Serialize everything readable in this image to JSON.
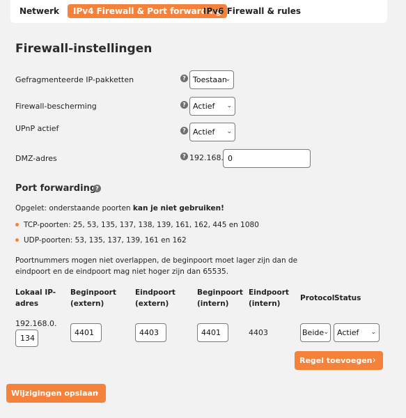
{
  "tabs": [
    {
      "label": "Netwerk"
    },
    {
      "label": "IPv4 Firewall & Port forwarding"
    },
    {
      "label": "IPv6 Firewall & rules"
    }
  ],
  "section_title": "Firewall-instellingen",
  "help_glyph": "?",
  "settings": {
    "fragmented": {
      "label": "Gefragmenteerde IP-pakketten",
      "value": "Toestaan"
    },
    "protection": {
      "label": "Firewall-bescherming",
      "value": "Actief"
    },
    "upnp": {
      "label": "UPnP actief",
      "value": "Actief"
    },
    "dmz": {
      "label": "DMZ-adres",
      "prefix": "192.168.0.",
      "value": "0"
    }
  },
  "port_forwarding": {
    "title": "Port forwarding",
    "warning_prefix": "Opgelet: onderstaande poorten ",
    "warning_bold": "kan je niet gebruiken!",
    "tcp": "TCP-poorten: 25, 53, 135, 137, 138, 139, 161, 162, 445 en 1080",
    "udp": "UDP-poorten: 53, 135, 137, 139, 161 en 162",
    "note_line1": "Poortnummers mogen niet overlappen, de beginpoort moet lager zijn dan de",
    "note_line2": "eindpoort en de eindpoort mag niet hoger zijn dan 65535."
  },
  "table": {
    "headers": {
      "local_ip_1": "Lokaal IP-",
      "local_ip_2": "adres",
      "begin_ext_1": "Beginpoort",
      "begin_ext_2": "(extern)",
      "end_ext_1": "Eindpoort",
      "end_ext_2": "(extern)",
      "begin_int_1": "Beginpoort",
      "begin_int_2": "(intern)",
      "end_int_1": "Eindpoort",
      "end_int_2": "(intern)",
      "protocol": "Protocol",
      "status": "Status"
    },
    "row": {
      "ip_prefix": "192.168.0.",
      "ip_value": "134",
      "begin_ext": "4401",
      "end_ext": "4403",
      "begin_int": "4401",
      "end_int": "4403",
      "protocol": "Beide",
      "status": "Actief"
    }
  },
  "buttons": {
    "add_rule": "Regel toevoegen",
    "save": "Wijzigingen opslaan",
    "arrow": "›",
    "dropdown_chevron": "⌄"
  },
  "colors": {
    "accent": "#f5823b",
    "help_icon": "#6f6f6f"
  }
}
